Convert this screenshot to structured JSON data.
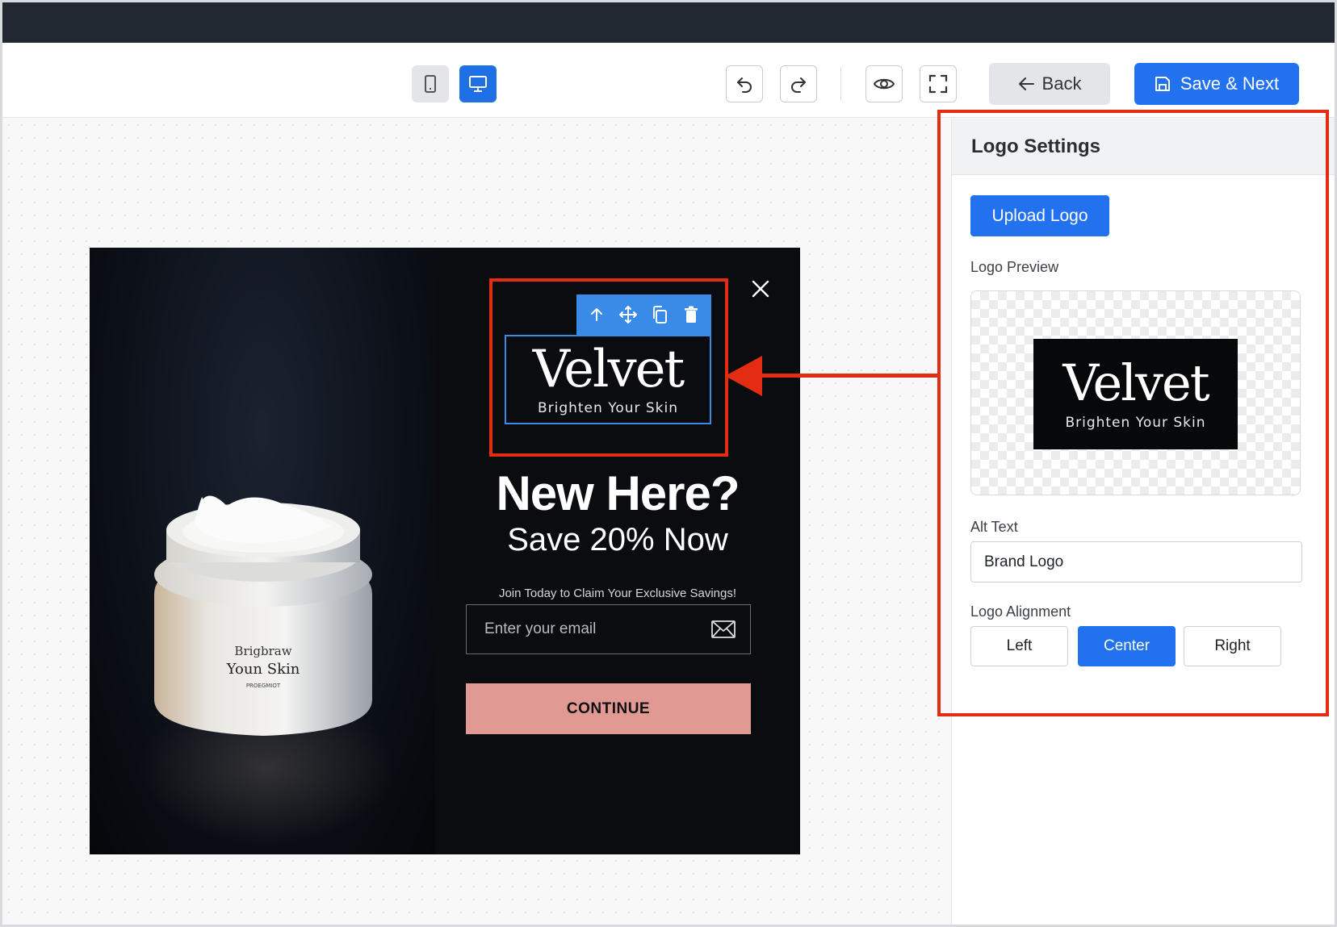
{
  "toolbar": {
    "mobile_view_icon": "mobile-icon",
    "desktop_view_icon": "desktop-icon",
    "undo_icon": "undo-icon",
    "redo_icon": "redo-icon",
    "preview_icon": "eye-icon",
    "fullscreen_icon": "fullscreen-icon",
    "back_label": "Back",
    "save_label": "Save & Next",
    "accent": "#2272ef"
  },
  "popup": {
    "close_icon": "close-icon",
    "logo": {
      "wordmark": "Velvet",
      "tagline": "Brighten Your Skin"
    },
    "logo_controls": [
      "arrow-up-icon",
      "move-icon",
      "duplicate-icon",
      "trash-icon"
    ],
    "headline": "New Here?",
    "subheadline": "Save 20% Now",
    "subtext": "Join Today to Claim Your Exclusive Savings!",
    "email_placeholder": "Enter your email",
    "email_icon": "mail-icon",
    "cta_label": "CONTINUE",
    "cta_color": "#e19994",
    "product_jar_label": {
      "line1": "Brigbraw",
      "line2": "Youn Skin",
      "line3": "PROEGMIOT"
    }
  },
  "panel": {
    "title": "Logo Settings",
    "upload_label": "Upload Logo",
    "preview_label": "Logo Preview",
    "alt_label": "Alt Text",
    "alt_value": "Brand Logo",
    "alignment_label": "Logo Alignment",
    "alignment_options": [
      "Left",
      "Center",
      "Right"
    ],
    "alignment_selected": "Center"
  },
  "annotation_color": "#e32c12"
}
